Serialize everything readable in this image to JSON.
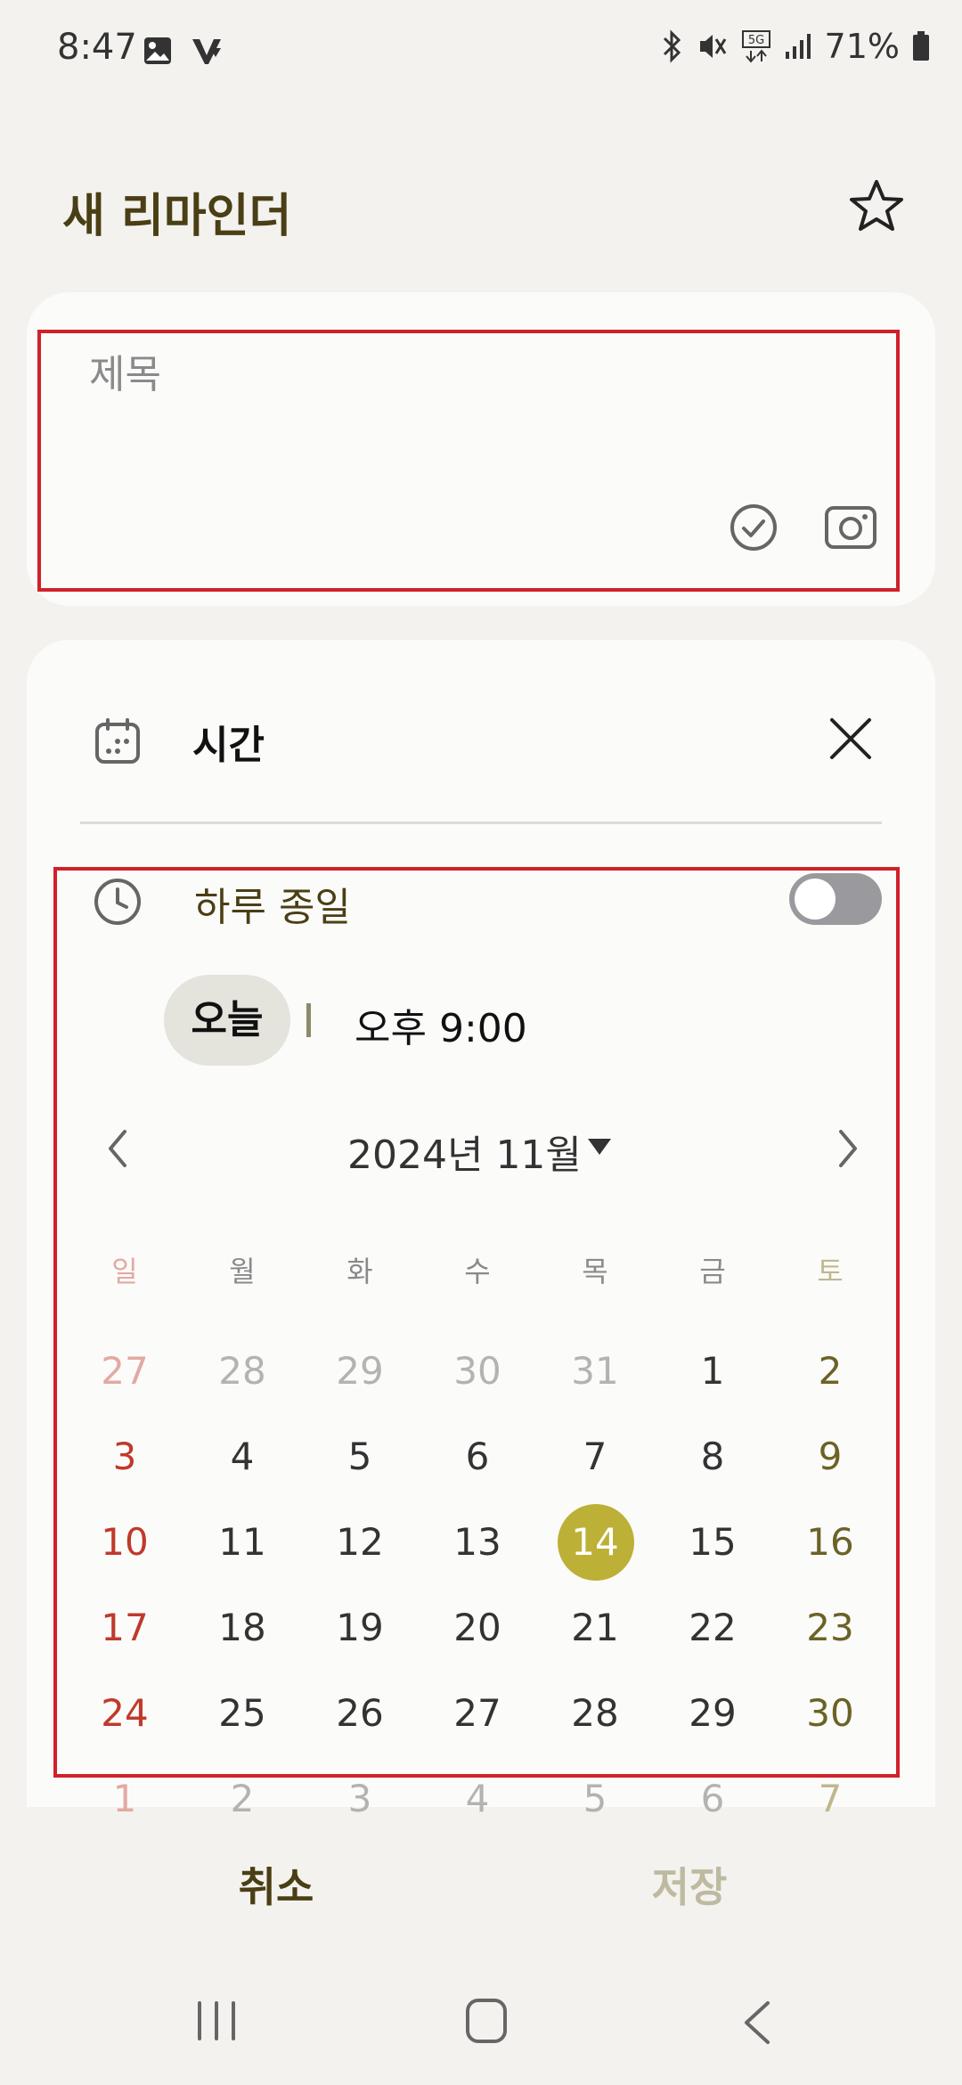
{
  "status_bar": {
    "time": "8:47",
    "network": "5G",
    "battery": "71%"
  },
  "header": {
    "title": "새 리마인더",
    "star_icon": "star-outline-icon"
  },
  "title_field": {
    "placeholder": "제목",
    "value": ""
  },
  "time_section": {
    "label": "시간",
    "all_day_label": "하루 종일",
    "all_day_on": false,
    "date_chip": "오늘",
    "time_value": "오후 9:00",
    "month_label": "2024년 11월"
  },
  "calendar": {
    "weekdays": [
      "일",
      "월",
      "화",
      "수",
      "목",
      "금",
      "토"
    ],
    "weeks": [
      [
        "27",
        "28",
        "29",
        "30",
        "31",
        "1",
        "2"
      ],
      [
        "3",
        "4",
        "5",
        "6",
        "7",
        "8",
        "9"
      ],
      [
        "10",
        "11",
        "12",
        "13",
        "14",
        "15",
        "16"
      ],
      [
        "17",
        "18",
        "19",
        "20",
        "21",
        "22",
        "23"
      ],
      [
        "24",
        "25",
        "26",
        "27",
        "28",
        "29",
        "30"
      ],
      [
        "1",
        "2",
        "3",
        "4",
        "5",
        "6",
        "7"
      ]
    ],
    "selected_day": "14",
    "colors": {
      "sunday": "#c0392b",
      "sunday_faded": "#e3a9a2",
      "saturday": "#6b6226",
      "saturday_faded": "#bfb88f",
      "weekday": "#333333",
      "faded": "#b3b3b3",
      "selected_bg": "#bdb037"
    }
  },
  "footer": {
    "cancel": "취소",
    "save": "저장"
  }
}
